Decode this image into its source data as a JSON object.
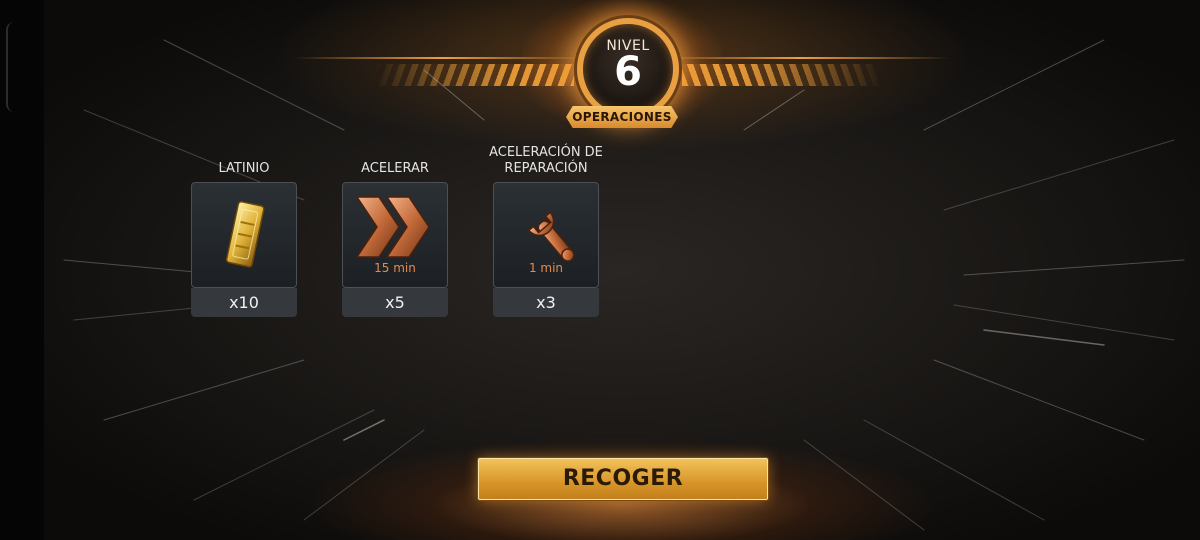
{
  "header": {
    "level_label": "NIVEL",
    "level_number": "6",
    "banner": "OPERACIONES"
  },
  "rewards": [
    {
      "title": "LATINIO",
      "quantity": "x10",
      "icon": "latinium-bar-icon",
      "time": ""
    },
    {
      "title": "ACELERAR",
      "quantity": "x5",
      "icon": "speedup-chevrons-icon",
      "time": "15 min"
    },
    {
      "title": "ACELERACIÓN DE REPARACIÓN",
      "quantity": "x3",
      "icon": "wrench-icon",
      "time": "1 min"
    }
  ],
  "actions": {
    "collect_label": "RECOGER"
  },
  "colors": {
    "accent_gold": "#e9a043",
    "button_gold": "#d79528",
    "time_copper": "#e58a4b",
    "card_bg": "#1c2024"
  }
}
